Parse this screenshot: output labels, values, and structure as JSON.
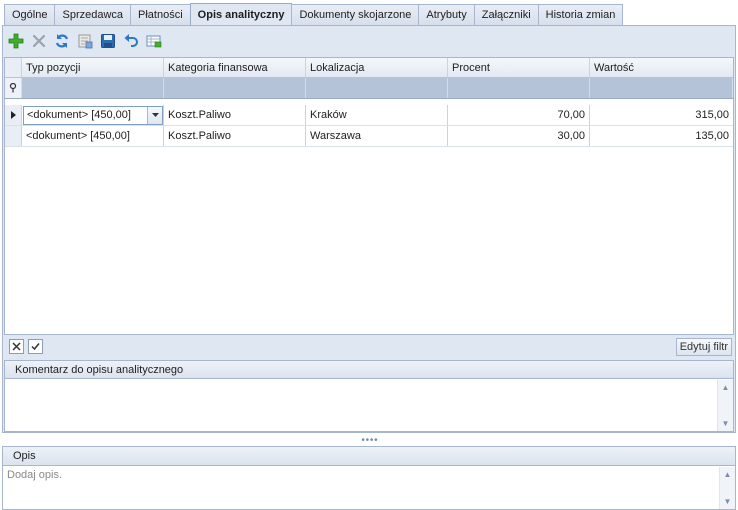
{
  "tabs": [
    {
      "label": "Ogólne"
    },
    {
      "label": "Sprzedawca"
    },
    {
      "label": "Płatności"
    },
    {
      "label": "Opis analityczny"
    },
    {
      "label": "Dokumenty skojarzone"
    },
    {
      "label": "Atrybuty"
    },
    {
      "label": "Załączniki"
    },
    {
      "label": "Historia zmian"
    }
  ],
  "active_tab": "Opis analityczny",
  "toolbar": {
    "icons": [
      "add-icon",
      "delete-icon",
      "refresh-icon",
      "edit-record-icon",
      "save-icon",
      "undo-icon",
      "grid-settings-icon"
    ]
  },
  "grid": {
    "columns": [
      "Typ pozycji",
      "Kategoria  finansowa",
      "Lokalizacja",
      "Procent",
      "Wartość"
    ],
    "rows": [
      {
        "typ": "<dokument>  [450,00]",
        "kategoria": "Koszt.Paliwo",
        "lokalizacja": "Kraków",
        "procent": "70,00",
        "wartosc": "315,00"
      },
      {
        "typ": "<dokument>  [450,00]",
        "kategoria": "Koszt.Paliwo",
        "lokalizacja": "Warszawa",
        "procent": "30,00",
        "wartosc": "135,00"
      }
    ],
    "edit_filter_label": "Edytuj filtr"
  },
  "comment": {
    "header": "Komentarz do opisu analitycznego",
    "value": ""
  },
  "opis": {
    "header": "Opis",
    "placeholder": "Dodaj opis."
  },
  "colors": {
    "panel": "#dfe7f2",
    "filter_row": "#b4c3d8",
    "border": "#a7b6cc"
  }
}
